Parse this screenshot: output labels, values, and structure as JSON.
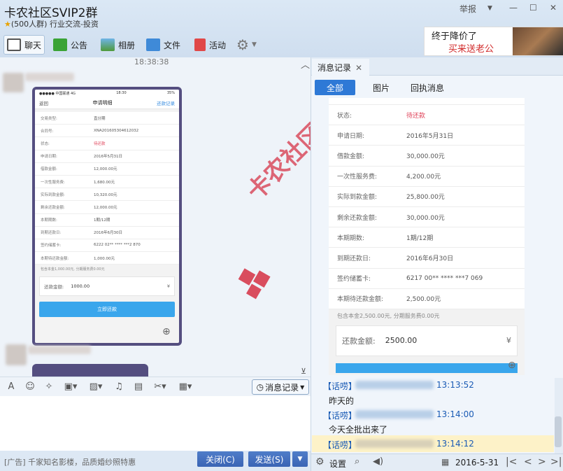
{
  "window": {
    "title": "卡农社区SVIP2群",
    "subtitle": "(500人群) 行业交流-投资",
    "report": "举报"
  },
  "toolbar": {
    "items": [
      {
        "label": "聊天"
      },
      {
        "label": "公告"
      },
      {
        "label": "相册"
      },
      {
        "label": "文件"
      },
      {
        "label": "活动"
      }
    ]
  },
  "ad_banner": {
    "line1": "终于降价了",
    "line2": "买来送老公"
  },
  "chat": {
    "timestamp": "18:38:38",
    "watermark": "卡农社区",
    "phone": {
      "status_carrier": "●●●●● 中国联通  4G",
      "status_time": "18:30",
      "status_battery": "35%",
      "back": "返回",
      "title": "申请明细",
      "link": "还款记录",
      "rows": [
        {
          "k": "交易类型:",
          "v": "直分期"
        },
        {
          "k": "合同号:",
          "v": "XNA20160530461203​2"
        },
        {
          "k": "状态:",
          "v": "待还款"
        },
        {
          "k": "申请日期:",
          "v": "2016年5月31日"
        },
        {
          "k": "借款金额:",
          "v": "12,000.00元"
        },
        {
          "k": "一次性服务费:",
          "v": "1,680.00元"
        },
        {
          "k": "实际到款金额:",
          "v": "10,320.00元"
        },
        {
          "k": "剩余还款金额:",
          "v": "12,000.00元"
        },
        {
          "k": "本期期数:",
          "v": "1期/12期"
        },
        {
          "k": "到期还款日:",
          "v": "2016年6月30日"
        },
        {
          "k": "签约储蓄卡:",
          "v": "6222 02** **** ***2 870"
        },
        {
          "k": "本期待还款金额:",
          "v": "1,000.00元"
        }
      ],
      "note": "包含本金1,000.00元, 分期服务费0.00元",
      "amount_label": "还款金额:",
      "amount_value": "1000.00",
      "currency": "¥",
      "button": "立即还款"
    }
  },
  "input_toolbar": {
    "message_record": "消息记录"
  },
  "bottom": {
    "ad_text": "[广告] 千家知名影楼，品质婚纱照特惠",
    "close": "关闭(C)",
    "send": "发送(S)"
  },
  "right": {
    "tab": "消息记录",
    "filters": [
      "全部",
      "图片",
      "回执消息"
    ],
    "rows": [
      {
        "k": "状态:",
        "v": "待还款"
      },
      {
        "k": "申请日期:",
        "v": "2016年5月31日"
      },
      {
        "k": "借款金额:",
        "v": "30,000.00元"
      },
      {
        "k": "一次性服务费:",
        "v": "4,200.00元"
      },
      {
        "k": "实际到款金额:",
        "v": "25,800.00元"
      },
      {
        "k": "剩余还款金额:",
        "v": "30,000.00元"
      },
      {
        "k": "本期期数:",
        "v": "1期/12期"
      },
      {
        "k": "到期还款日:",
        "v": "2016年6月30日"
      },
      {
        "k": "签约储蓄卡:",
        "v": "6217 00** **** ***7 069"
      },
      {
        "k": "本期待还款金额:",
        "v": "2,500.00元"
      }
    ],
    "note": "包含本金2,500.00元, 分期服务费0.00元",
    "amount_label": "还款金额:",
    "amount_value": "2500.00",
    "currency": "¥",
    "log": [
      {
        "tag": "【话唠】",
        "time": "13:13:52",
        "text": "昨天的"
      },
      {
        "tag": "【话唠】",
        "time": "13:14:00",
        "text": "今天全批出来了"
      },
      {
        "tag": "【话唠】",
        "time": "13:14:12",
        "text": ""
      }
    ],
    "settings": "设置",
    "date": "2016-5-31"
  }
}
